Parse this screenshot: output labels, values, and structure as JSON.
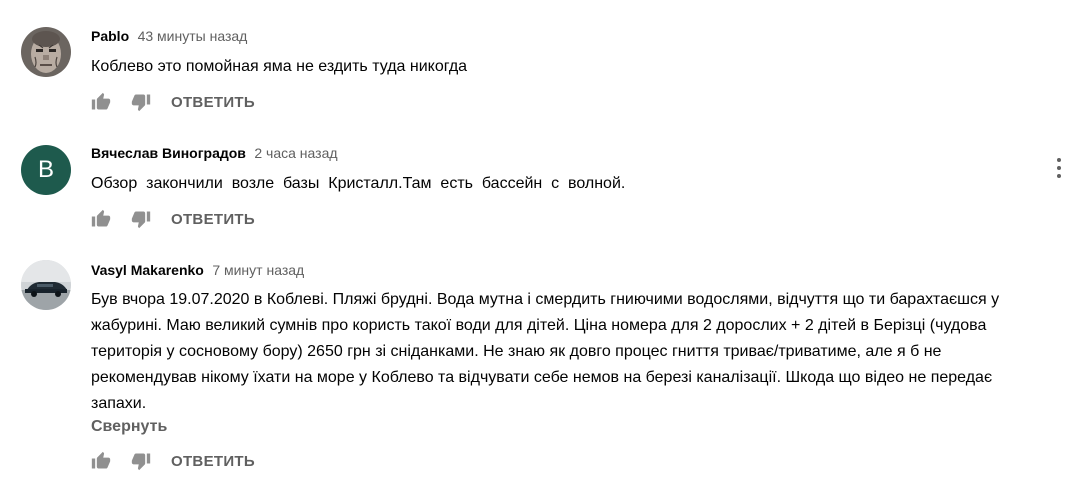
{
  "comments": [
    {
      "author": "Pablo",
      "time": "43 минуты назад",
      "text": "Коблево это помойная яма не ездить туда никогда",
      "reply_label": "ОТВЕТИТЬ",
      "avatar_type": "photo-face"
    },
    {
      "author": "Вячеслав Виноградов",
      "time": "2 часа назад",
      "text": "Обзор  закончили  возле  базы  Кристалл.Там  есть  бассейн  с  волной.",
      "reply_label": "ОТВЕТИТЬ",
      "avatar_letter": "В",
      "avatar_color": "#1e5a4d"
    },
    {
      "author": "Vasyl Makarenko",
      "time": "7 минут назад",
      "text": "Був вчора 19.07.2020 в Коблеві. Пляжі брудні. Вода мутна і смердить гниючими водослями, відчуття що ти барахтаєшся у жабурині. Маю великий сумнів про користь такої води для дітей. Ціна номера для 2 дорослих + 2 дітей в Берізці (чудова територія у сосновому бору) 2650 грн зі сніданками. Не знаю як довго процес гниття триває/триватиме, але я б не рекомендував нікому їхати на море у Коблево та відчувати себе немов на березі каналізації. Шкода що відео не передає запахи.",
      "collapse_label": "Свернуть",
      "reply_label": "ОТВЕТИТЬ",
      "avatar_type": "photo-car"
    }
  ],
  "icons": {
    "like": "thumb-up-icon",
    "dislike": "thumb-down-icon",
    "menu": "more-vert-icon"
  }
}
